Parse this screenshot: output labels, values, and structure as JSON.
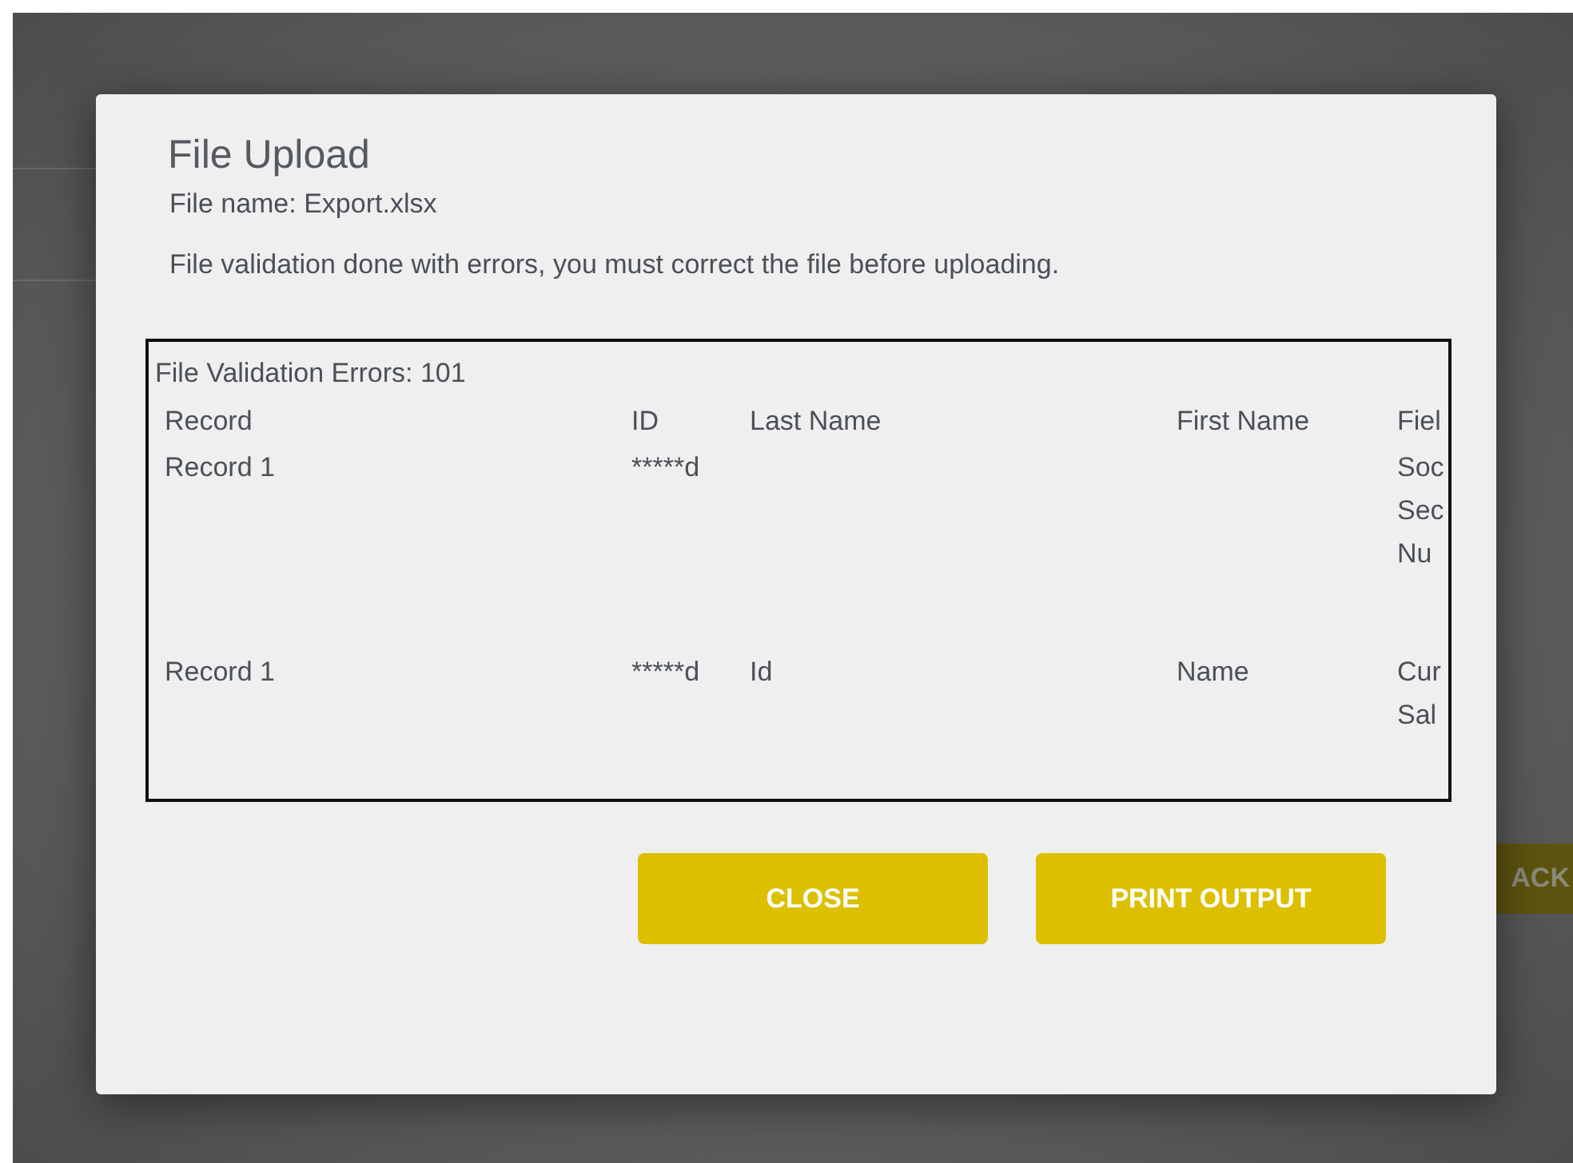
{
  "background": {
    "button_fragment": "ACK"
  },
  "dialog": {
    "title": "File Upload",
    "file_name": "File name: Export.xlsx",
    "message": "File validation done with errors, you must correct the file before uploading.",
    "errors": {
      "summary": "File Validation Errors: 101",
      "columns": [
        "Record",
        "ID",
        "Last Name",
        "First Name",
        "Fiel"
      ],
      "rows": [
        {
          "cells": [
            [
              "Record 1"
            ],
            [
              "*****d"
            ],
            [],
            [],
            [
              "Soc",
              "Sec",
              "Nu"
            ]
          ]
        },
        {
          "cells": [
            [
              "Record 1"
            ],
            [
              "*****d"
            ],
            [
              "Id"
            ],
            [
              "Name"
            ],
            [
              "Cur",
              "Sal"
            ]
          ]
        }
      ]
    },
    "buttons": [
      "CLOSE",
      "PRINT OUTPUT"
    ]
  }
}
